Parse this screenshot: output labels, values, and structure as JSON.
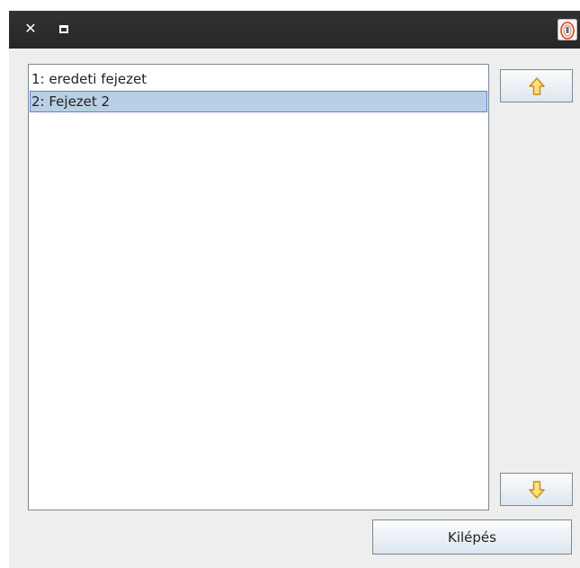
{
  "titlebar": {
    "close_icon": "close-icon",
    "maximize_icon": "maximize-icon",
    "app_icon": "app-logo-icon"
  },
  "chapters": {
    "items": [
      {
        "label": "1: eredeti fejezet",
        "selected": false
      },
      {
        "label": "2: Fejezet 2",
        "selected": true
      }
    ]
  },
  "buttons": {
    "move_up_icon": "arrow-up-icon",
    "move_down_icon": "arrow-down-icon",
    "exit_label": "Kilépés"
  },
  "colors": {
    "titlebar": "#2b2b2b",
    "selection": "#b8cfe5",
    "selection_border": "#6382bf",
    "arrow_fill": "#ffe17a",
    "arrow_stroke": "#c88a10"
  }
}
